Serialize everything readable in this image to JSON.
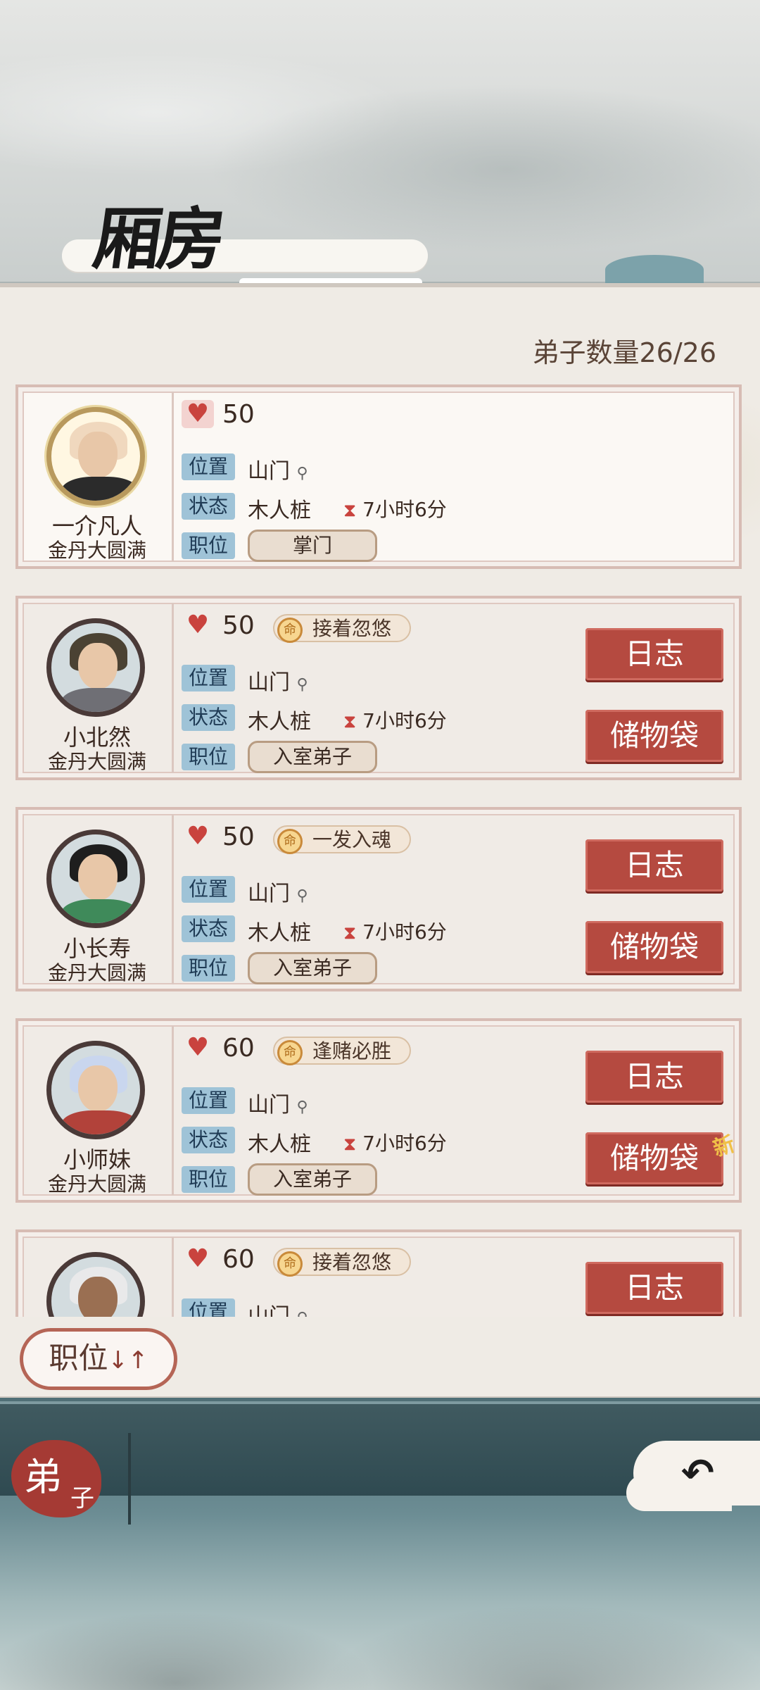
{
  "header": {
    "title": "厢房"
  },
  "summary": {
    "count_text": "弟子数量26/26"
  },
  "labels": {
    "location": "位置",
    "status": "状态",
    "role": "职位"
  },
  "disciples": [
    {
      "name": "一介凡人",
      "realm": "金丹大圆满",
      "hp": "50",
      "location": "山门",
      "status": "木人桩",
      "timer": "7小时6分",
      "role": "掌门",
      "trait": "",
      "log_label": "",
      "bag_label": ""
    },
    {
      "name": "小北然",
      "realm": "金丹大圆满",
      "hp": "50",
      "location": "山门",
      "status": "木人桩",
      "timer": "7小时6分",
      "role": "入室弟子",
      "trait": "接着忽悠",
      "log_label": "日志",
      "bag_label": "储物袋"
    },
    {
      "name": "小长寿",
      "realm": "金丹大圆满",
      "hp": "50",
      "location": "山门",
      "status": "木人桩",
      "timer": "7小时6分",
      "role": "入室弟子",
      "trait": "一发入魂",
      "log_label": "日志",
      "bag_label": "储物袋"
    },
    {
      "name": "小师妹",
      "realm": "金丹大圆满",
      "hp": "60",
      "location": "山门",
      "status": "木人桩",
      "timer": "7小时6分",
      "role": "入室弟子",
      "trait": "逢赌必胜",
      "log_label": "日志",
      "bag_label": "储物袋",
      "bag_badge": "新"
    },
    {
      "name": "",
      "realm": "",
      "hp": "60",
      "location": "山门",
      "status": "",
      "timer": "",
      "role": "",
      "trait": "接着忽悠",
      "log_label": "日志",
      "bag_label": ""
    }
  ],
  "sort_button": {
    "label": "职位",
    "arrows": "↓↑"
  },
  "bottom": {
    "tab_big": "弟",
    "tab_small": "子",
    "back_icon": "back-arrow-icon"
  },
  "colors": {
    "heart": "#c9433e",
    "button": "#b54a40",
    "tag": "#9fc3d7",
    "panel": "#efebe5"
  }
}
